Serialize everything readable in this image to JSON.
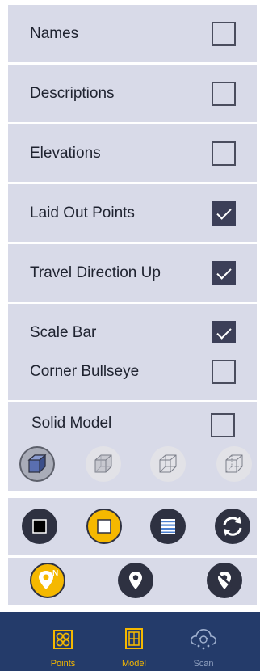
{
  "options": [
    {
      "label": "Names",
      "checked": false
    },
    {
      "label": "Descriptions",
      "checked": false
    },
    {
      "label": "Elevations",
      "checked": false
    },
    {
      "label": "Laid Out Points",
      "checked": true
    },
    {
      "label": "Travel Direction Up",
      "checked": true
    },
    {
      "label": "Scale Bar",
      "checked": true
    },
    {
      "label": "Corner Bullseye",
      "checked": false
    }
  ],
  "solid_model": {
    "label": "Solid Model",
    "checked": false
  },
  "view_modes": [
    "solid-cube-icon",
    "shaded-cube-icon",
    "wireframe-cube-icon",
    "hidden-line-cube-icon"
  ],
  "render_modes": [
    "black-square-icon",
    "white-square-icon",
    "striped-list-icon",
    "refresh-icon"
  ],
  "pin_modes": [
    "north-pin-icon",
    "location-pin-icon",
    "hidden-pin-icon"
  ],
  "nav": {
    "items": [
      {
        "label": "Points",
        "icon": "points-icon",
        "active": true
      },
      {
        "label": "Model",
        "icon": "model-icon",
        "active": true
      },
      {
        "label": "Scan",
        "icon": "scan-cloud-icon",
        "active": false
      }
    ]
  },
  "colors": {
    "panel_bg": "#d8dae8",
    "accent_yellow": "#f5b800",
    "navbar_bg": "#243b6a",
    "dark_circle": "#2e3141"
  }
}
